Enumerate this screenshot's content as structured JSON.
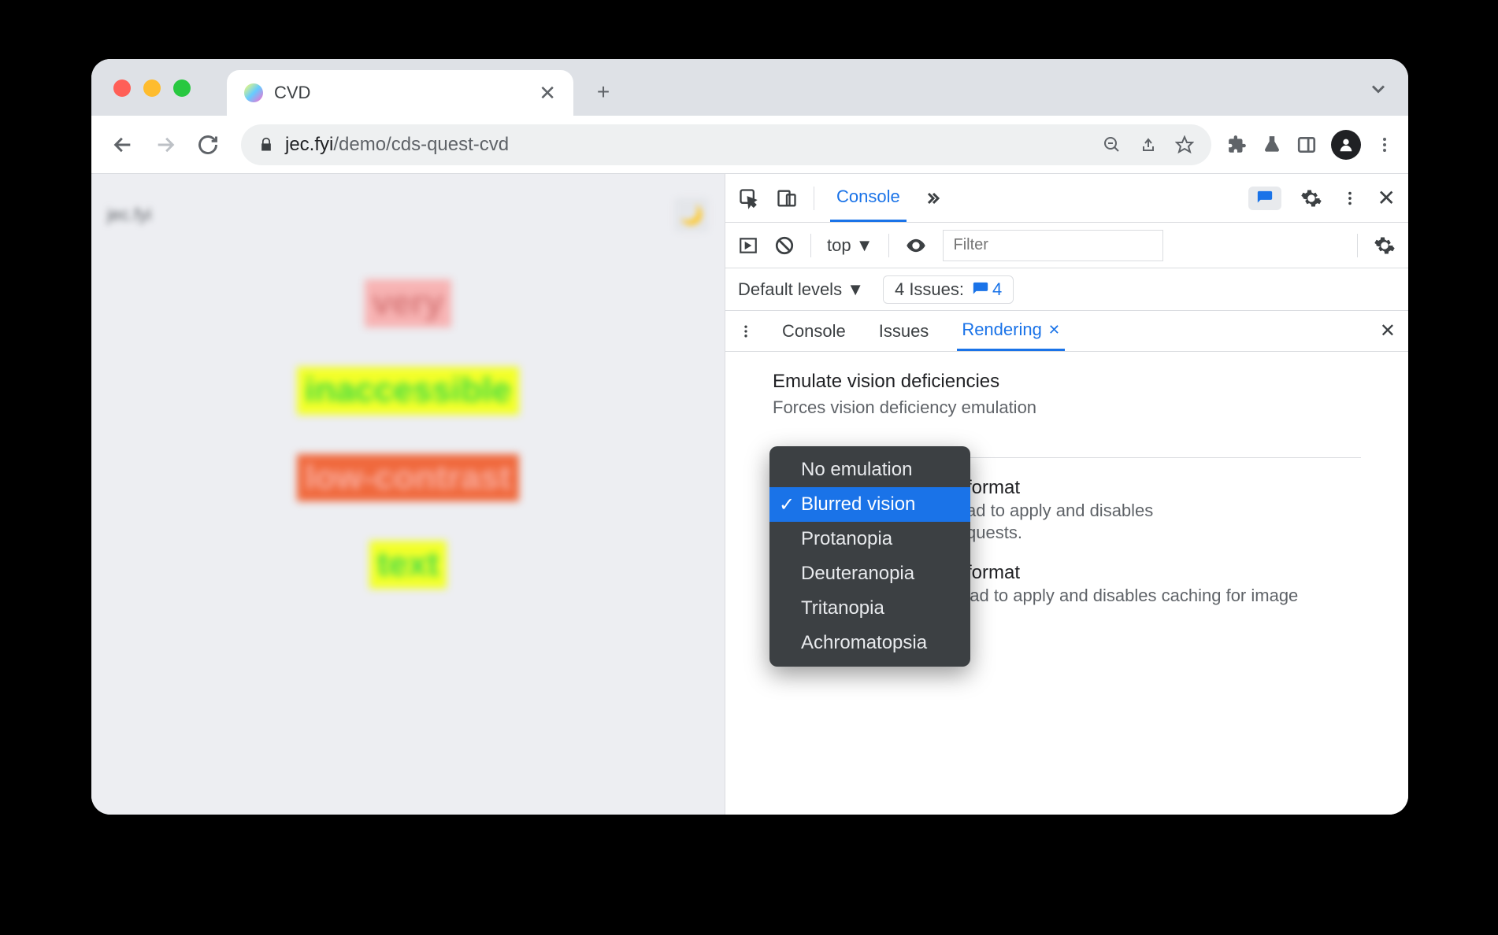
{
  "browser": {
    "tab_title": "CVD",
    "url_domain": "jec.fyi",
    "url_path": "/demo/cds-quest-cvd"
  },
  "page": {
    "site_title": "jec.fyi",
    "samples": [
      "very",
      "inaccessible",
      "low-contrast",
      "text"
    ]
  },
  "devtools": {
    "main_tabs": {
      "active": "Console"
    },
    "context": "top",
    "filter_placeholder": "Filter",
    "levels_label": "Default levels",
    "issues_label": "4 Issues:",
    "issues_count": "4",
    "drawer_tabs": [
      "Console",
      "Issues",
      "Rendering"
    ],
    "drawer_active": "Rendering",
    "section": {
      "title": "Emulate vision deficiencies",
      "desc": "Forces vision deficiency emulation"
    },
    "dropdown": [
      "No emulation",
      "Blurred vision",
      "Protanopia",
      "Deuteranopia",
      "Tritanopia",
      "Achromatopsia"
    ],
    "dropdown_selected": "Blurred vision",
    "options": [
      {
        "title_suffix": "format",
        "desc": "ad to apply and disables",
        "desc2": "quests."
      },
      {
        "title_suffix": "format",
        "desc": "Requires a page reload to apply and disables caching for image requests."
      }
    ]
  }
}
